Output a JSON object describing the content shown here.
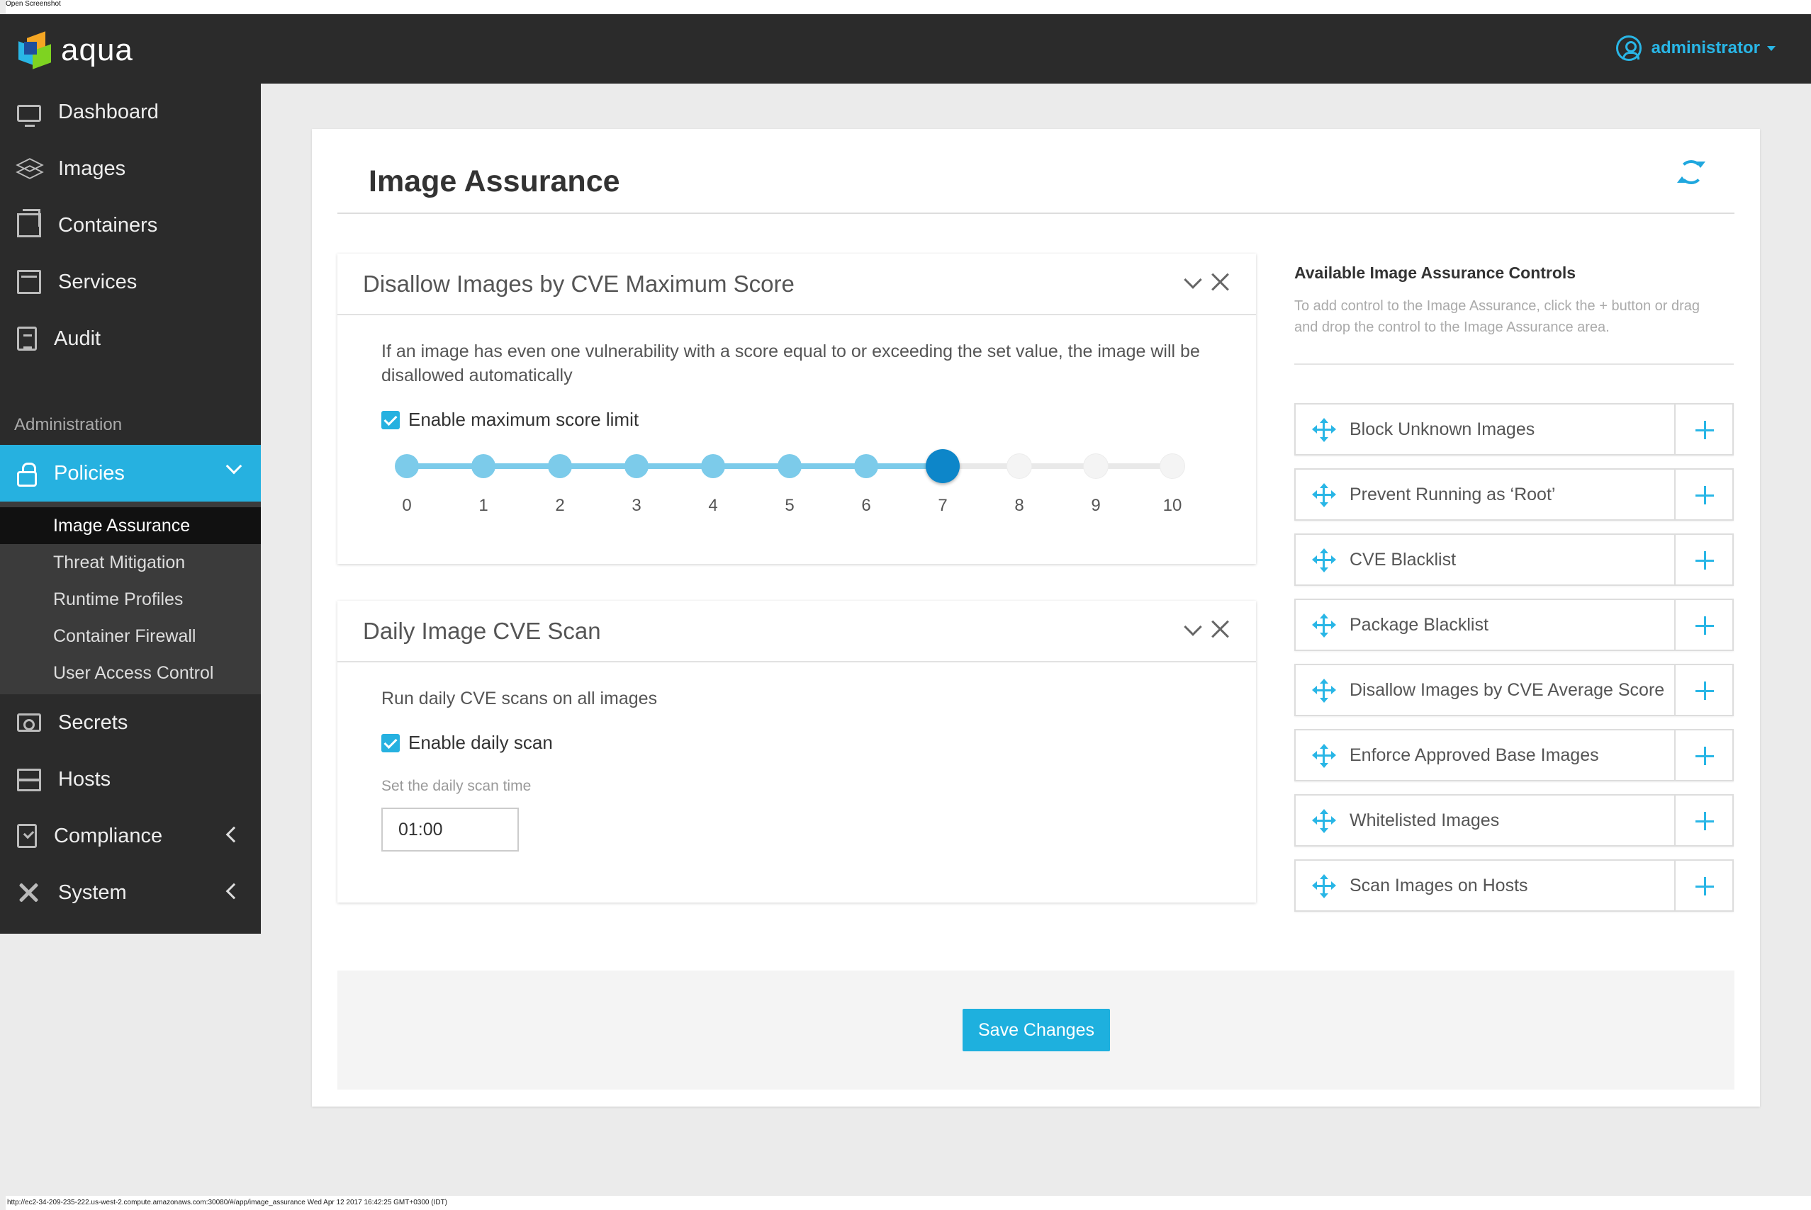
{
  "caption": "Open Screenshot",
  "footer_url": "http://ec2-34-209-235-222.us-west-2.compute.amazonaws.com:30080/#/app/image_assurance Wed Apr 12 2017 16:42:25 GMT+0300 (IDT)",
  "app": {
    "name": "aqua",
    "brand_colors": [
      "#f5a623",
      "#29b6e6",
      "#7ed321",
      "#1f4e9c"
    ],
    "accent": "#26b1e0"
  },
  "user": {
    "name": "administrator",
    "icon": "user-circle-icon"
  },
  "sidebar": {
    "items": [
      {
        "label": "Dashboard",
        "icon": "monitor-icon"
      },
      {
        "label": "Images",
        "icon": "layers-icon"
      },
      {
        "label": "Containers",
        "icon": "box-icon"
      },
      {
        "label": "Services",
        "icon": "stack-icon"
      },
      {
        "label": "Audit",
        "icon": "clipboard-icon"
      }
    ],
    "section_label": "Administration",
    "policies": {
      "label": "Policies",
      "icon": "lock-icon",
      "expanded": true,
      "subitems": [
        "Image Assurance",
        "Threat Mitigation",
        "Runtime Profiles",
        "Container Firewall",
        "User Access Control"
      ],
      "current": "Image Assurance"
    },
    "items_after": [
      {
        "label": "Secrets",
        "icon": "safe-icon"
      },
      {
        "label": "Hosts",
        "icon": "server-icon"
      },
      {
        "label": "Compliance",
        "icon": "clipboard-check-icon",
        "has_children": true
      },
      {
        "label": "System",
        "icon": "tools-icon",
        "has_children": true
      }
    ]
  },
  "main": {
    "title": "Image Assurance",
    "refresh_icon": "refresh-icon",
    "panels": [
      {
        "title": "Disallow Images by CVE Maximum Score",
        "description": "If an image has even one vulnerability with a score equal to or exceeding the set value, the image will be disallowed automatically",
        "checkbox_label": "Enable maximum score limit",
        "checked": true,
        "slider": {
          "ticks": [
            "0",
            "1",
            "2",
            "3",
            "4",
            "5",
            "6",
            "7",
            "8",
            "9",
            "10"
          ],
          "value": 7
        }
      },
      {
        "title": "Daily Image CVE Scan",
        "description": "Run daily CVE scans on all images",
        "checkbox_label": "Enable daily scan",
        "checked": true,
        "time_label": "Set the daily scan time",
        "time_value": "01:00"
      }
    ],
    "available": {
      "title": "Available Image Assurance Controls",
      "help": "To add control to the Image Assurance, click the + button or drag and drop the control to the Image Assurance area.",
      "controls": [
        "Block Unknown Images",
        "Prevent Running as ‘Root’",
        "CVE Blacklist",
        "Package Blacklist",
        "Disallow Images by CVE Average Score",
        "Enforce Approved Base Images",
        "Whitelisted Images",
        "Scan Images on Hosts"
      ]
    },
    "save_label": "Save Changes"
  }
}
